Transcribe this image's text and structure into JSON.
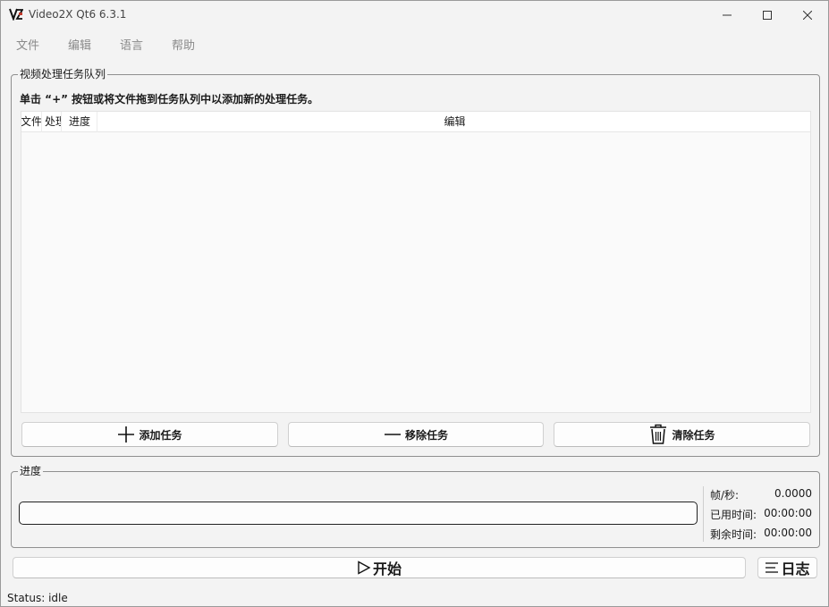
{
  "window": {
    "title": "Video2X Qt6 6.3.1"
  },
  "menu": {
    "items": [
      "文件",
      "编辑",
      "语言",
      "帮助"
    ]
  },
  "queue": {
    "group_title": "视频处理任务队列",
    "hint": "单击 “+” 按钮或将文件拖到任务队列中以添加新的处理任务。",
    "columns": [
      "文件",
      "处理",
      "进度",
      "编辑"
    ],
    "rows": [],
    "add_label": "添加任务",
    "remove_label": "移除任务",
    "clear_label": "清除任务"
  },
  "progress": {
    "group_title": "进度",
    "percent": 0,
    "fps_label": "帧/秒:",
    "fps_value": "0.0000",
    "elapsed_label": "已用时间:",
    "elapsed_value": "00:00:00",
    "remaining_label": "剩余时间:",
    "remaining_value": "00:00:00"
  },
  "actions": {
    "start_label": "开始",
    "log_label": "日志"
  },
  "status": {
    "text": "Status: idle"
  },
  "icons": {
    "app": "video2x-logo-icon",
    "add": "plus-icon",
    "remove": "minus-icon",
    "clear": "trash-icon",
    "start": "play-icon",
    "log": "list-icon"
  }
}
